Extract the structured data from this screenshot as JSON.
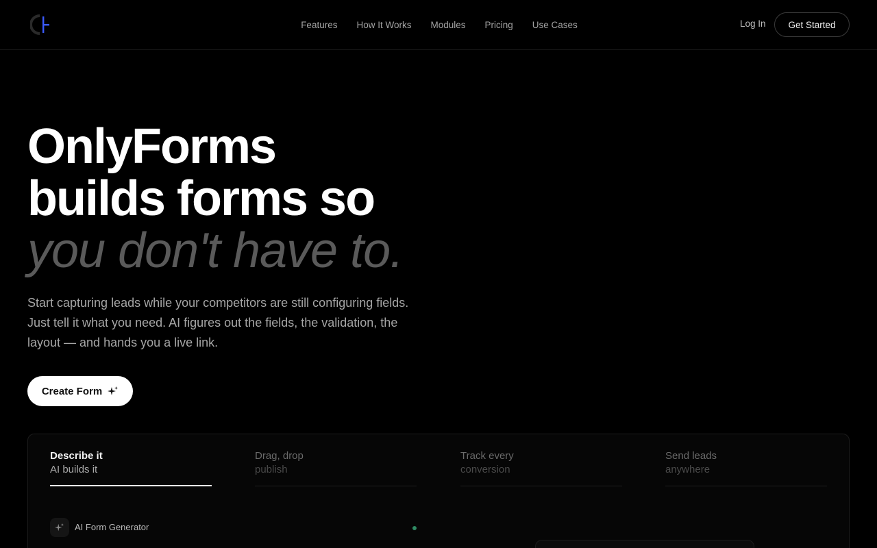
{
  "nav": {
    "items": [
      "Features",
      "How It Works",
      "Modules",
      "Pricing",
      "Use Cases"
    ],
    "login": "Log In",
    "get_started": "Get Started"
  },
  "hero": {
    "line1": "OnlyForms",
    "line2": "builds forms so",
    "line3": "you don't have to.",
    "subtitle": "Start capturing leads while your competitors are still configuring fields. Just tell it what you need. AI figures out the fields, the validation, the layout — and hands you a live link.",
    "cta": "Create Form"
  },
  "features": {
    "tabs": [
      {
        "title": "Describe it",
        "subtitle": "AI builds it",
        "active": true
      },
      {
        "title": "Drag, drop",
        "subtitle": "publish",
        "active": false
      },
      {
        "title": "Track every",
        "subtitle": "conversion",
        "active": false
      },
      {
        "title": "Send leads",
        "subtitle": "anywhere",
        "active": false
      }
    ],
    "generator_label": "AI Form Generator"
  },
  "colors": {
    "background": "#000000",
    "accent_logo": "#3b5bff",
    "status_dot": "#2f8a63"
  }
}
